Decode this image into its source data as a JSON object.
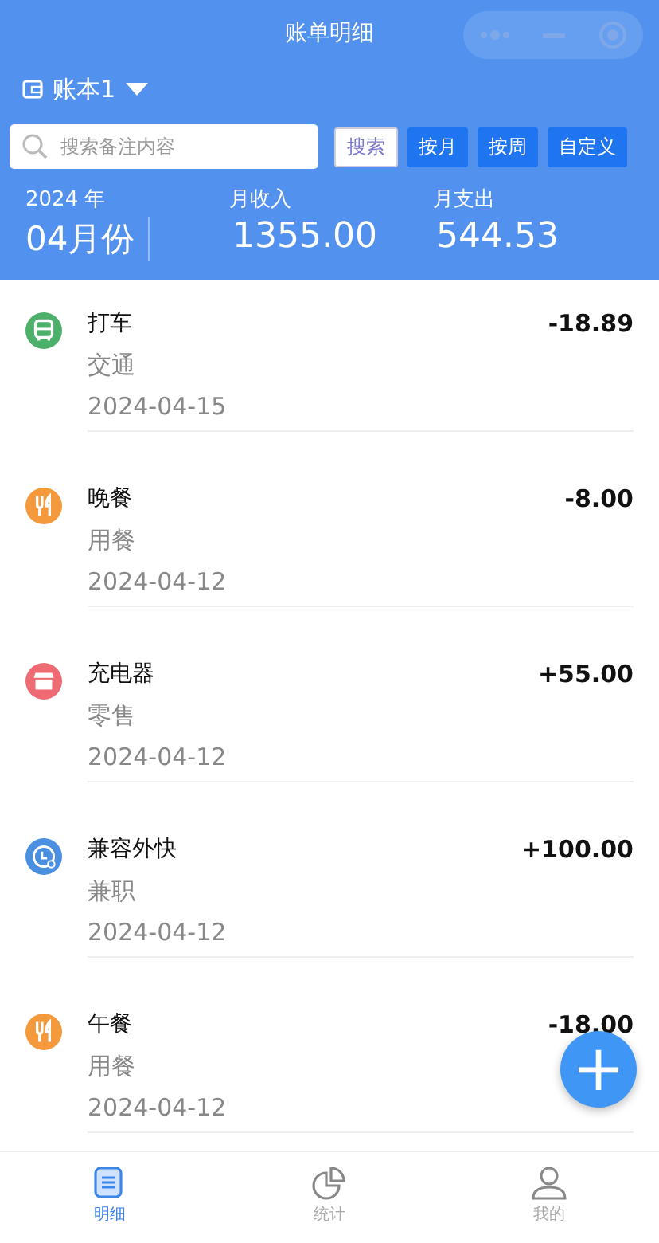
{
  "window": {
    "title": "账单明细"
  },
  "book": {
    "name": "账本1"
  },
  "search": {
    "placeholder": "搜索备注内容",
    "button": "搜索"
  },
  "filters": [
    {
      "label": "按月"
    },
    {
      "label": "按周"
    },
    {
      "label": "自定义"
    }
  ],
  "summary": {
    "year": "2024 年",
    "month": "04月份",
    "income_label": "月收入",
    "income": "1355.00",
    "expense_label": "月支出",
    "expense": "544.53"
  },
  "records": [
    {
      "title": "打车",
      "category": "交通",
      "date": "2024-04-15",
      "amount": "-18.89",
      "kind": "bus",
      "color": "#4caf6a"
    },
    {
      "title": "晚餐",
      "category": "用餐",
      "date": "2024-04-12",
      "amount": "-8.00",
      "kind": "food",
      "color": "#f59a3c"
    },
    {
      "title": "充电器",
      "category": "零售",
      "date": "2024-04-12",
      "amount": "+55.00",
      "kind": "shop",
      "color": "#ef6b73"
    },
    {
      "title": "兼容外快",
      "category": "兼职",
      "date": "2024-04-12",
      "amount": "+100.00",
      "kind": "clock",
      "color": "#4a8fe0"
    },
    {
      "title": "午餐",
      "category": "用餐",
      "date": "2024-04-12",
      "amount": "-18.00",
      "kind": "food",
      "color": "#f59a3c"
    }
  ],
  "fab": {
    "label": "+"
  },
  "tabs": [
    {
      "label": "明细",
      "kind": "list",
      "selected": true
    },
    {
      "label": "统计",
      "kind": "chart",
      "selected": false
    },
    {
      "label": "我的",
      "kind": "user",
      "selected": false
    }
  ]
}
